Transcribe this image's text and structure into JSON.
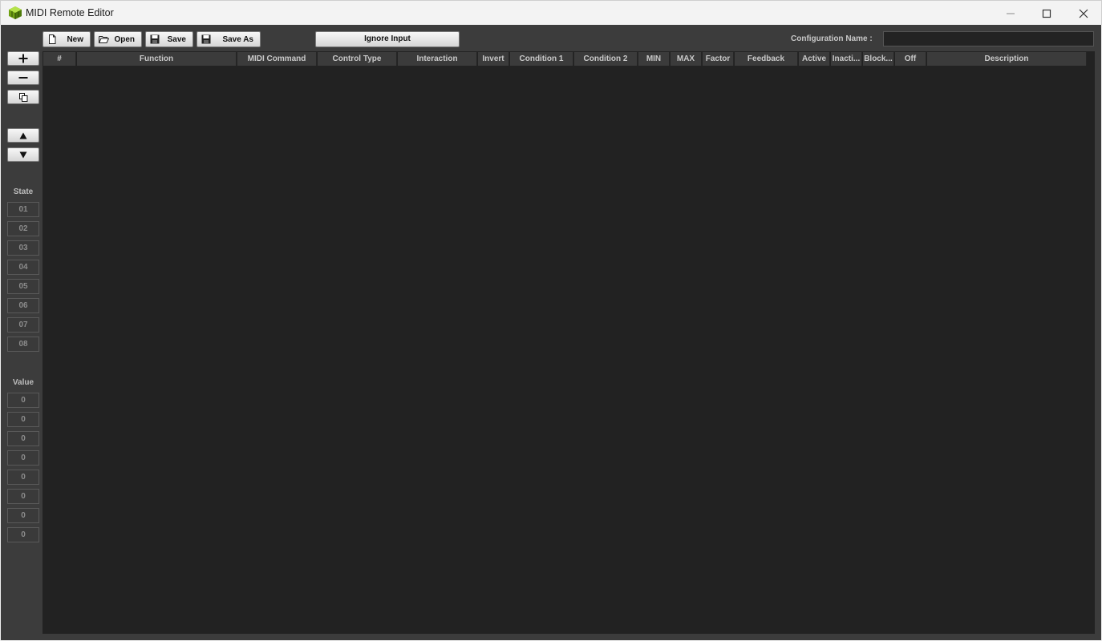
{
  "window": {
    "title": "MIDI Remote Editor",
    "controls": {
      "minimize": "—",
      "maximize": "☐",
      "close": "✕"
    }
  },
  "toolbar": {
    "new_label": "New",
    "open_label": "Open",
    "save_label": "Save",
    "save_as_label": "Save As",
    "ignore_input_label": "Ignore Input",
    "config_name_label": "Configuration Name :",
    "config_name_value": ""
  },
  "left_panel": {
    "add_symbol": "+",
    "remove_symbol": "−",
    "up_symbol": "▲",
    "down_symbol": "▼",
    "state_label": "State",
    "states": [
      "01",
      "02",
      "03",
      "04",
      "05",
      "06",
      "07",
      "08"
    ],
    "value_label": "Value",
    "values": [
      "0",
      "0",
      "0",
      "0",
      "0",
      "0",
      "0",
      "0"
    ]
  },
  "table": {
    "columns": [
      "#",
      "Function",
      "MIDI Command",
      "Control Type",
      "Interaction",
      "Invert",
      "Condition 1",
      "Condition 2",
      "MIN",
      "MAX",
      "Factor",
      "Feedback",
      "Active",
      "Inacti...",
      "Block...",
      "Off",
      "Description"
    ],
    "rows": []
  },
  "colors": {
    "app_background": "#3c3c3c",
    "table_background": "#222222",
    "header_background": "#3b3b3b",
    "accent_icon": "#9ad21e"
  }
}
